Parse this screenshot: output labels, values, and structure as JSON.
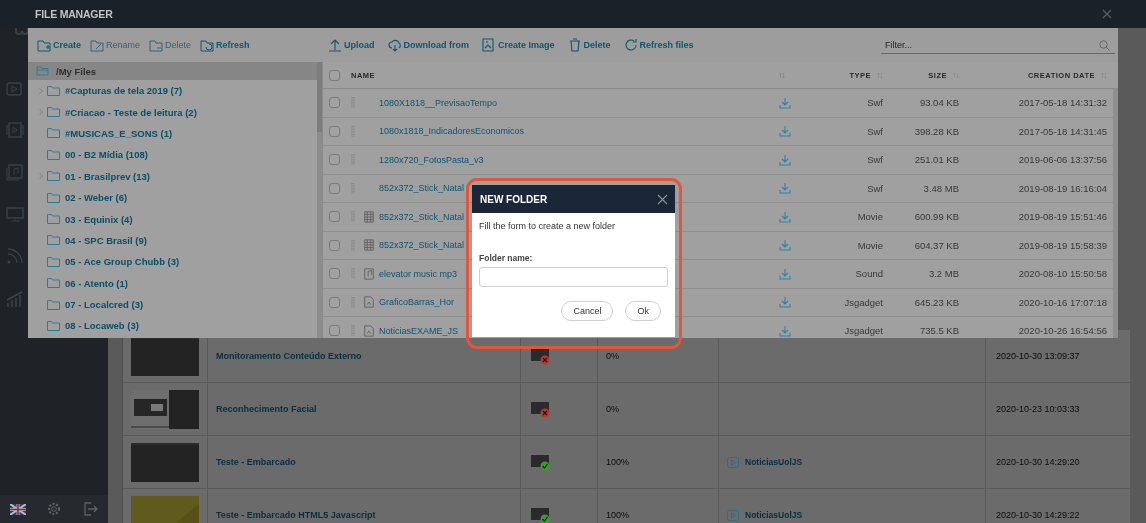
{
  "background_list": {
    "rows": [
      {
        "name": "Monitoramento Conteúdo Externo",
        "failed": true,
        "progress": "0%",
        "date": "2020-10-30 13:09:37"
      },
      {
        "name": "Reconhecimento Facial",
        "failed": true,
        "progress": "0%",
        "date": "2020-10-23 10:03:33"
      },
      {
        "name": "Teste - Embarcado",
        "failed": false,
        "progress": "100%",
        "link": "NoticiasUolJS",
        "date": "2020-10-30 14:29:20"
      },
      {
        "name": "Teste - Embarcado HTML5 Javascript",
        "failed": false,
        "progress": "100%",
        "link": "NoticiasUolJS",
        "date": "2020-10-30 14:29:22"
      }
    ]
  },
  "file_manager": {
    "title": "FILE MANAGER",
    "tree_toolbar": [
      {
        "label": "Create",
        "disabled": false
      },
      {
        "label": "Rename",
        "disabled": true
      },
      {
        "label": "Delete",
        "disabled": true
      },
      {
        "label": "Refresh",
        "disabled": false
      }
    ],
    "file_toolbar": [
      "Upload",
      "Download from",
      "Create Image",
      "Delete",
      "Refresh files"
    ],
    "filter": {
      "placeholder": "Filter..."
    },
    "tree": {
      "root": {
        "label": "/My Files",
        "selected": true
      },
      "folders": [
        {
          "label": "#Capturas de tela 2019 (7)",
          "expandable": true,
          "selected": false
        },
        {
          "label": "#Criacao - Teste de leitura (2)",
          "expandable": true,
          "selected": false
        },
        {
          "label": "#MUSICAS_E_SONS (1)",
          "expandable": false,
          "selected": false
        },
        {
          "label": "00 - B2 Mídia (108)",
          "expandable": false,
          "selected": false
        },
        {
          "label": "01 - Brasilprev (13)",
          "expandable": true,
          "selected": false
        },
        {
          "label": "02 - Weber (6)",
          "expandable": false,
          "selected": false
        },
        {
          "label": "03 - Equinix (4)",
          "expandable": false,
          "selected": false
        },
        {
          "label": "04 - SPC Brasil (9)",
          "expandable": false,
          "selected": false
        },
        {
          "label": "05 - Ace Group Chubb (3)",
          "expandable": false,
          "selected": false
        },
        {
          "label": "06 - Atento (1)",
          "expandable": false,
          "selected": false
        },
        {
          "label": "07 - Localcred (3)",
          "expandable": false,
          "selected": false
        },
        {
          "label": "08 - Locaweb (3)",
          "expandable": false,
          "selected": false
        }
      ]
    },
    "table": {
      "columns": [
        "NAME",
        "TYPE",
        "SIZE",
        "CREATION DATE"
      ],
      "all_checked": false,
      "rows": [
        {
          "checked": false,
          "kind": "swf",
          "name": "1080X1818__PrevisaoTempo",
          "type": "Swf",
          "size": "93.04 KB",
          "date": "2017-05-18 14:31:32"
        },
        {
          "checked": false,
          "kind": "swf",
          "name": "1080x1818_IndicadoresEconomicos",
          "type": "Swf",
          "size": "398.28 KB",
          "date": "2017-05-18 14:31:45"
        },
        {
          "checked": false,
          "kind": "swf",
          "name": "1280x720_FotosPasta_v3",
          "type": "Swf",
          "size": "251.01 KB",
          "date": "2019-06-06 13:37:56"
        },
        {
          "checked": false,
          "kind": "swf",
          "name": "852x372_Stick_Natal",
          "type": "Swf",
          "size": "3.48 MB",
          "date": "2019-08-19 16:16:04"
        },
        {
          "checked": false,
          "kind": "movie",
          "name": "852x372_Stick_Natal",
          "type": "Movie",
          "size": "600.99 KB",
          "date": "2019-08-19 15:51:46"
        },
        {
          "checked": false,
          "kind": "movie",
          "name": "852x372_Stick_Natal",
          "type": "Movie",
          "size": "604.37 KB",
          "date": "2019-08-19 15:58:39"
        },
        {
          "checked": false,
          "kind": "sound",
          "name": "elevator music mp3",
          "type": "Sound",
          "size": "3.2 MB",
          "date": "2020-08-10 15:50:58"
        },
        {
          "checked": false,
          "kind": "gadget",
          "name": "GraficoBarras_Hor",
          "type": "Jsgadget",
          "size": "645.23 KB",
          "date": "2020-10-16 17:07:18"
        },
        {
          "checked": false,
          "kind": "gadget",
          "name": "NoticiasEXAME_JS",
          "type": "Jsgadget",
          "size": "735.5 KB",
          "date": "2020-10-26 16:54:56"
        }
      ]
    }
  },
  "new_folder_dialog": {
    "title": "NEW FOLDER",
    "message": "Fill the form to create a new folder",
    "field_label": "Folder name:",
    "buttons": [
      "Cancel",
      "Ok"
    ]
  }
}
